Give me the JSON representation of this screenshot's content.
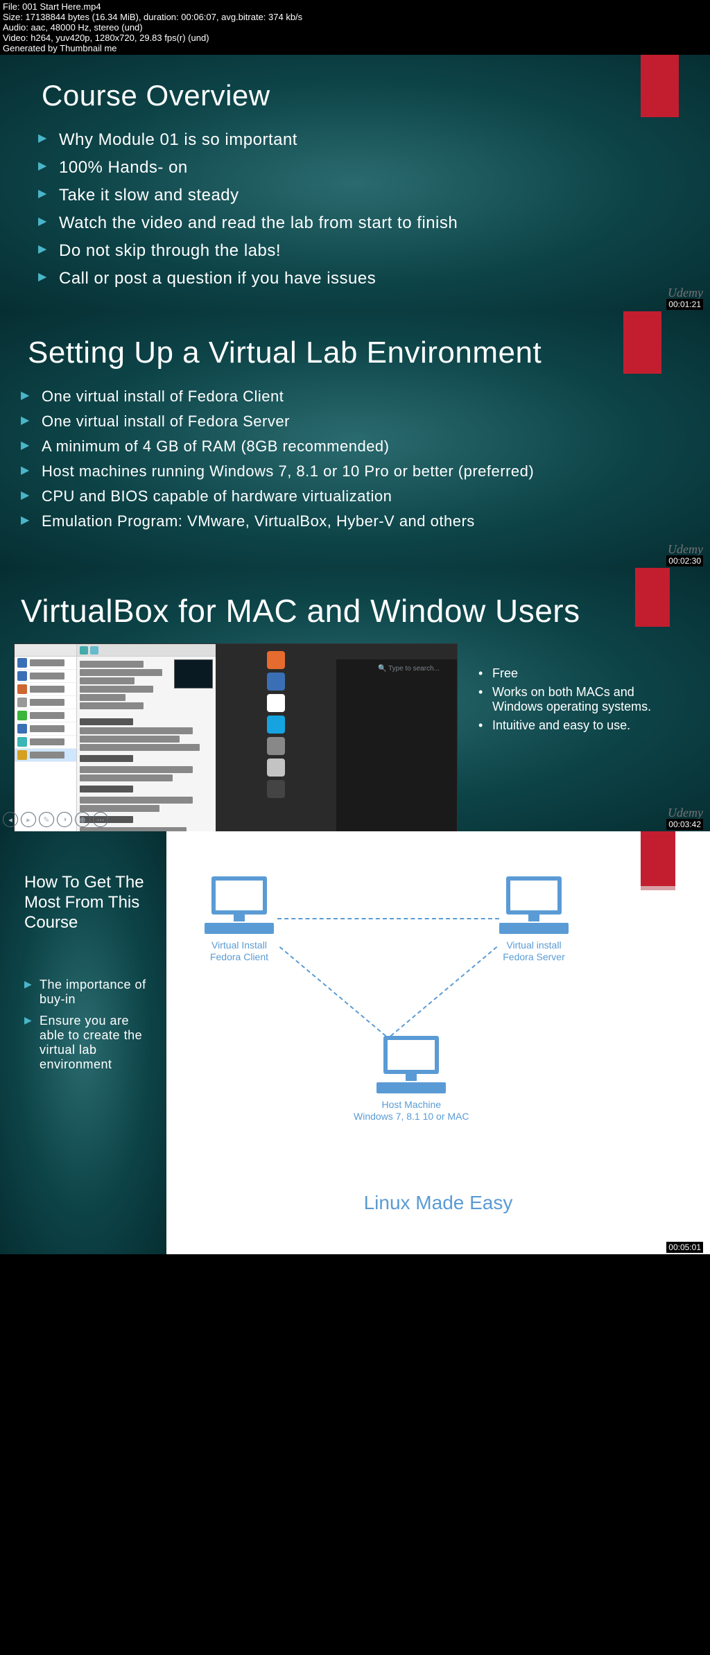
{
  "meta": {
    "file": "File: 001 Start Here.mp4",
    "size": "Size: 17138844 bytes (16.34 MiB), duration: 00:06:07, avg.bitrate: 374 kb/s",
    "audio": "Audio: aac, 48000 Hz, stereo (und)",
    "video": "Video: h264, yuv420p, 1280x720, 29.83 fps(r) (und)",
    "gen": "Generated by Thumbnail me"
  },
  "watermark": "Udemy",
  "slide1": {
    "title": "Course Overview",
    "items": [
      "Why Module 01 is so important",
      "100% Hands- on",
      "Take it slow and steady",
      "Watch the video and read the lab from start to finish",
      "Do not skip through the labs!",
      "Call or post a question if you have issues"
    ],
    "timestamp": "00:01:21"
  },
  "slide2": {
    "title": "Setting Up a Virtual Lab Environment",
    "items": [
      "One virtual install of Fedora Client",
      "One virtual install of Fedora Server",
      "A minimum of 4 GB of RAM (8GB recommended)",
      "Host machines running Windows 7, 8.1 or 10 Pro or better (preferred)",
      "CPU and BIOS capable of hardware virtualization",
      "Emulation Program: VMware, VirtualBox, Hyber-V and others"
    ],
    "timestamp": "00:02:30"
  },
  "slide3": {
    "title": "VirtualBox for MAC and Window Users",
    "side": [
      "Free",
      "Works on both MACs and Windows operating systems.",
      "Intuitive and easy to use."
    ],
    "timestamp": "00:03:42"
  },
  "slide4": {
    "left_title": "How To Get The Most From This Course",
    "bullets": [
      "The importance of buy-in",
      "Ensure you are able to create the virtual lab environment"
    ],
    "nodes": {
      "client": "Virtual Install\nFedora Client",
      "server": "Virtual install\nFedora Server",
      "host": "Host Machine\nWindows 7, 8.1 10 or MAC"
    },
    "footer": "Linux Made Easy",
    "timestamp": "00:05:01"
  }
}
